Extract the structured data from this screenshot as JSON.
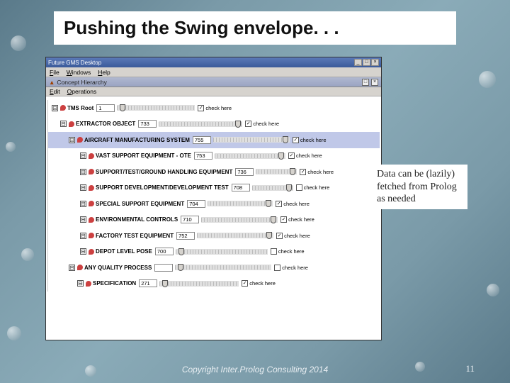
{
  "slide": {
    "title": "Pushing the Swing envelope. . .",
    "callout": "Data can be (lazily) fetched from Prolog as needed",
    "copyright": "Copyright Inter.Prolog Consulting 2014",
    "page": "11"
  },
  "app": {
    "title": "Future GMS Desktop",
    "menubar": [
      "File",
      "Windows",
      "Help"
    ],
    "panel_title": "Concept Hierarchy",
    "panel_menu": [
      "Edit",
      "Operations"
    ],
    "check_label": "check here",
    "rows": [
      {
        "indent": 6,
        "label": "TMS Root",
        "num": "1",
        "slider": 110,
        "thumb": 4,
        "checked": true,
        "hl": false
      },
      {
        "indent": 18,
        "label": "EXTRACTOR OBJECT",
        "num": "733",
        "slider": 118,
        "thumb": 108,
        "checked": true,
        "hl": false
      },
      {
        "indent": 30,
        "label": "AIRCRAFT MANUFACTURING SYSTEM",
        "num": "755",
        "slider": 108,
        "thumb": 98,
        "checked": true,
        "hl": true
      },
      {
        "indent": 46,
        "label": "VAST SUPPORT EQUIPMENT - OTE",
        "num": "753",
        "slider": 100,
        "thumb": 90,
        "checked": true,
        "hl": false
      },
      {
        "indent": 46,
        "label": "SUPPORT/TEST/GROUND HANDLING EQUIPMENT",
        "num": "736",
        "slider": 58,
        "thumb": 48,
        "checked": true,
        "hl": false
      },
      {
        "indent": 46,
        "label": "SUPPORT DEVELOPMENT/DEVELOPMENT TEST",
        "num": "708",
        "slider": 58,
        "thumb": 48,
        "checked": false,
        "hl": false
      },
      {
        "indent": 46,
        "label": "SPECIAL SUPPORT EQUIPMENT",
        "num": "704",
        "slider": 92,
        "thumb": 82,
        "checked": true,
        "hl": false
      },
      {
        "indent": 46,
        "label": "ENVIRONMENTAL CONTROLS",
        "num": "710",
        "slider": 108,
        "thumb": 98,
        "checked": true,
        "hl": false
      },
      {
        "indent": 46,
        "label": "FACTORY TEST EQUIPMENT",
        "num": "752",
        "slider": 108,
        "thumb": 98,
        "checked": true,
        "hl": false
      },
      {
        "indent": 46,
        "label": "DEPOT LEVEL POSE",
        "num": "700",
        "slider": 130,
        "thumb": 4,
        "checked": false,
        "hl": false
      },
      {
        "indent": 30,
        "label": "ANY QUALITY PROCESS",
        "num": "",
        "slider": 136,
        "thumb": 4,
        "checked": false,
        "hl": false
      },
      {
        "indent": 42,
        "label": "SPECIFICATION",
        "num": "271",
        "slider": 112,
        "thumb": 4,
        "checked": true,
        "hl": false
      }
    ]
  }
}
